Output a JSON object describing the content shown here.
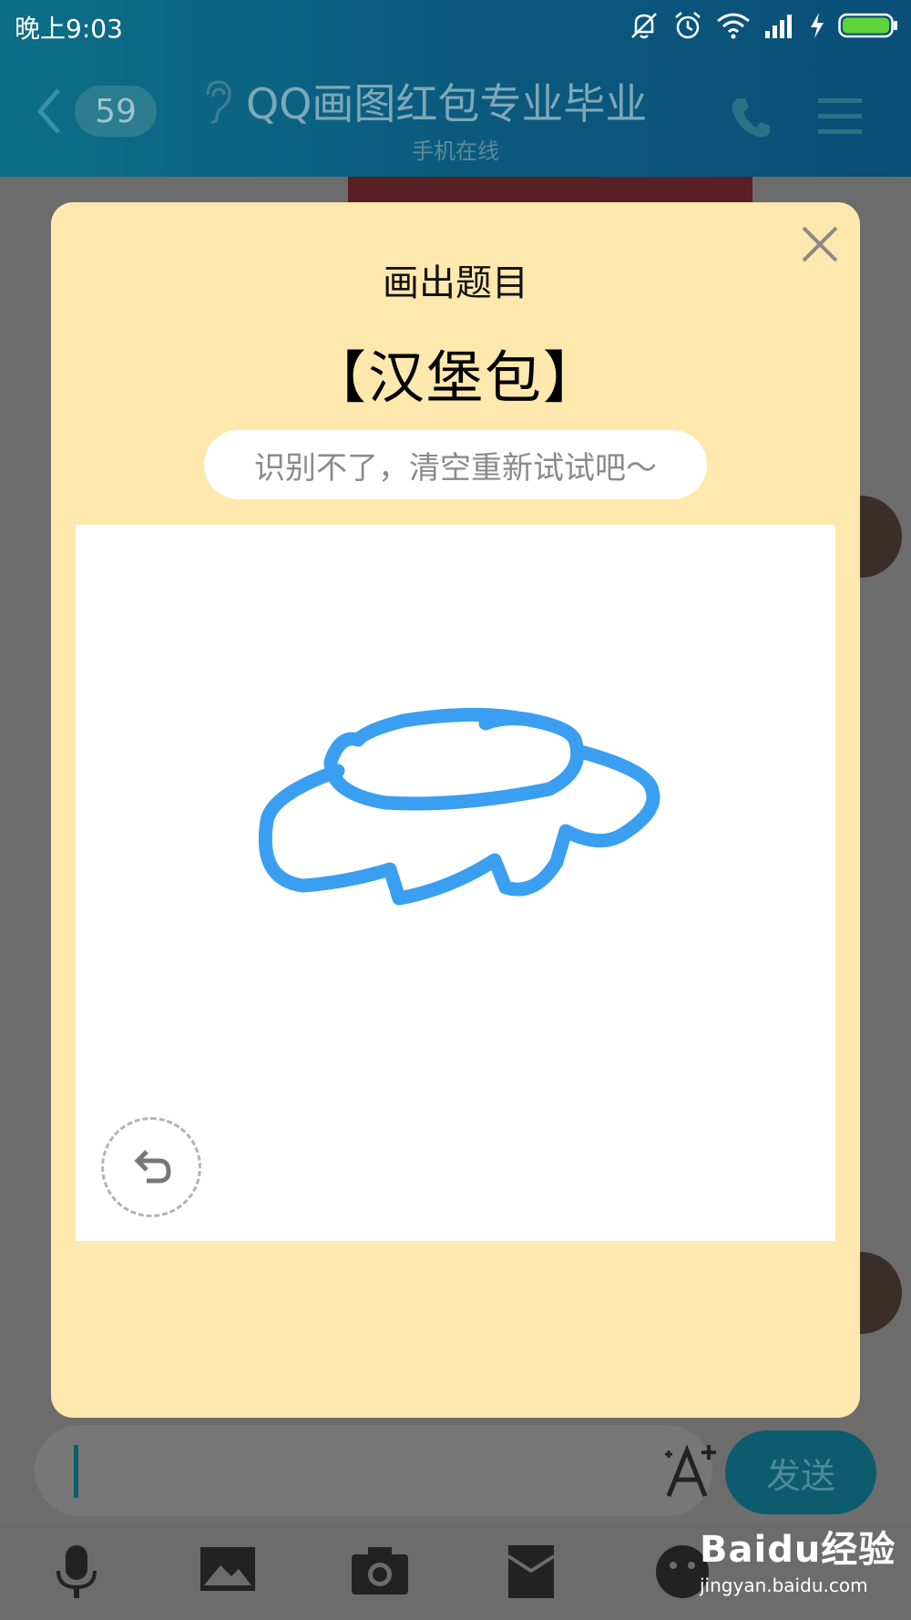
{
  "status_bar": {
    "time": "晚上9:03",
    "icons": [
      "mute-icon",
      "alarm-icon",
      "wifi-icon",
      "signal-icon",
      "charging-icon",
      "battery-icon"
    ],
    "battery_color": "#5fd33a"
  },
  "chat_header": {
    "back_count": "59",
    "title": "QQ画图红包专业毕业",
    "subtitle": "手机在线"
  },
  "modal": {
    "title": "画出题目",
    "topic": "【汉堡包】",
    "hint": "识别不了，清空重新试试吧～",
    "stroke_color": "#3a9ff0",
    "background": "#fee8ad"
  },
  "input_bar": {
    "send_label": "发送"
  },
  "toolbar": {
    "icons": [
      "microphone-icon",
      "image-icon",
      "camera-icon",
      "red-packet-icon",
      "emoji-icon"
    ]
  },
  "watermark": {
    "logo": "Baidu经验",
    "url": "jingyan.baidu.com"
  }
}
